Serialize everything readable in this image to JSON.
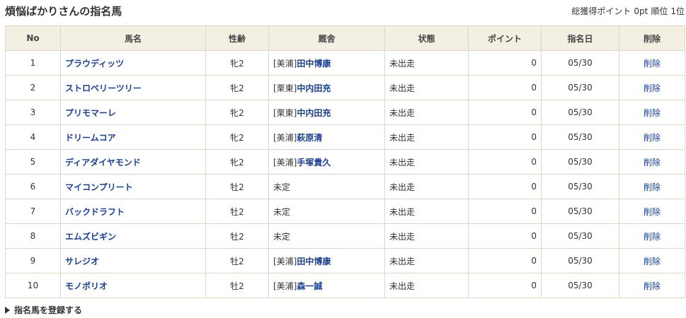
{
  "header": {
    "title": "煩悩ばかりさんの指名馬",
    "summary_label": "総獲得ポイント",
    "points": "0pt",
    "rank_label": "順位",
    "rank": "1位"
  },
  "table": {
    "columns": [
      "No",
      "馬名",
      "性齢",
      "厩舎",
      "状態",
      "ポイント",
      "指名日",
      "削除"
    ],
    "rows": [
      {
        "no": "1",
        "name": "プラウディッツ",
        "sex_age": "牝2",
        "region": "[美浦]",
        "trainer": "田中博康",
        "status": "未出走",
        "points": "0",
        "date": "05/30",
        "delete": "削除"
      },
      {
        "no": "2",
        "name": "ストロベリーツリー",
        "sex_age": "牝2",
        "region": "[栗東]",
        "trainer": "中内田充",
        "status": "未出走",
        "points": "0",
        "date": "05/30",
        "delete": "削除"
      },
      {
        "no": "3",
        "name": "プリモマーレ",
        "sex_age": "牝2",
        "region": "[栗東]",
        "trainer": "中内田充",
        "status": "未出走",
        "points": "0",
        "date": "05/30",
        "delete": "削除"
      },
      {
        "no": "4",
        "name": "ドリームコア",
        "sex_age": "牝2",
        "region": "[美浦]",
        "trainer": "萩原清",
        "status": "未出走",
        "points": "0",
        "date": "05/30",
        "delete": "削除"
      },
      {
        "no": "5",
        "name": "ディアダイヤモンド",
        "sex_age": "牝2",
        "region": "[美浦]",
        "trainer": "手塚貴久",
        "status": "未出走",
        "points": "0",
        "date": "05/30",
        "delete": "削除"
      },
      {
        "no": "6",
        "name": "マイコンプリート",
        "sex_age": "牡2",
        "region": "",
        "trainer": "未定",
        "status": "未出走",
        "points": "0",
        "date": "05/30",
        "delete": "削除"
      },
      {
        "no": "7",
        "name": "バックドラフト",
        "sex_age": "牡2",
        "region": "",
        "trainer": "未定",
        "status": "未出走",
        "points": "0",
        "date": "05/30",
        "delete": "削除"
      },
      {
        "no": "8",
        "name": "エムズビギン",
        "sex_age": "牡2",
        "region": "",
        "trainer": "未定",
        "status": "未出走",
        "points": "0",
        "date": "05/30",
        "delete": "削除"
      },
      {
        "no": "9",
        "name": "サレジオ",
        "sex_age": "牡2",
        "region": "[美浦]",
        "trainer": "田中博康",
        "status": "未出走",
        "points": "0",
        "date": "05/30",
        "delete": "削除"
      },
      {
        "no": "10",
        "name": "モノポリオ",
        "sex_age": "牡2",
        "region": "[美浦]",
        "trainer": "森一誠",
        "status": "未出走",
        "points": "0",
        "date": "05/30",
        "delete": "削除"
      }
    ]
  },
  "footer": {
    "register_label": "指名馬を登録する",
    "register_icon": "triangle-right-icon"
  },
  "colors": {
    "header_bg": "#f3efe3",
    "border": "#dcd6c6",
    "link": "#1a3f8f"
  }
}
